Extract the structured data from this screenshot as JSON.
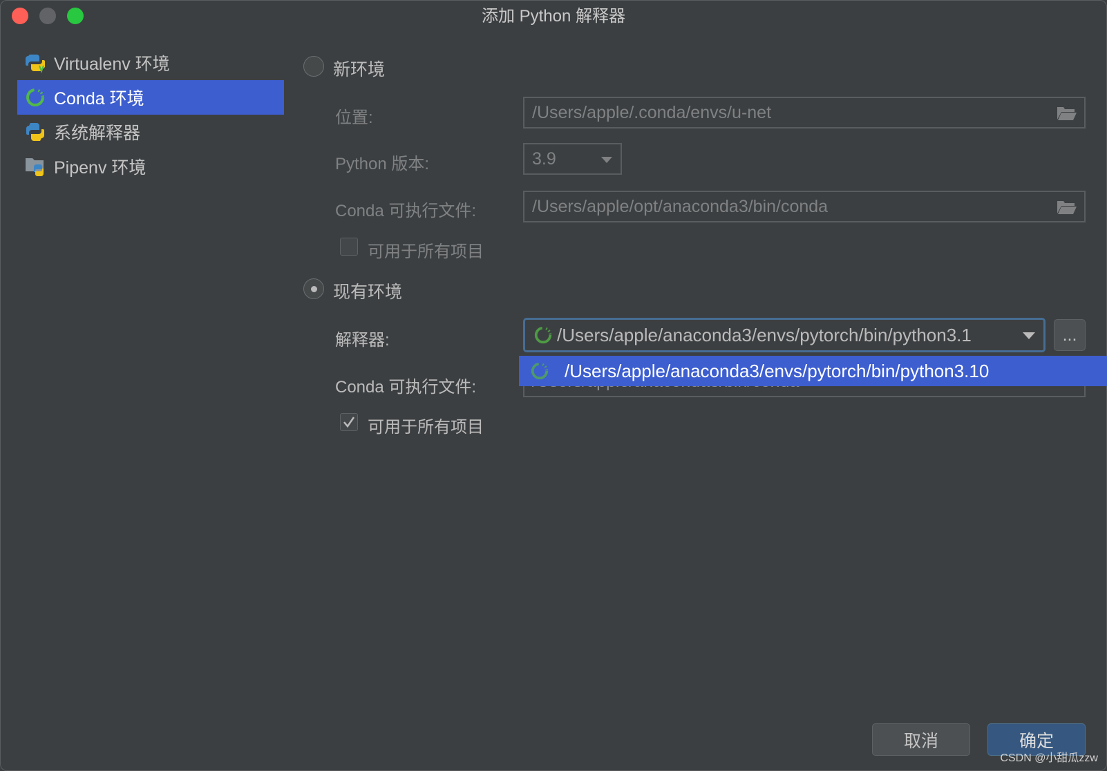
{
  "window": {
    "title": "添加 Python 解释器"
  },
  "sidebar": {
    "items": [
      {
        "label": "Virtualenv 环境",
        "icon": "python-virtualenv-icon"
      },
      {
        "label": "Conda 环境",
        "icon": "conda-icon",
        "selected": true
      },
      {
        "label": "系统解释器",
        "icon": "python-icon"
      },
      {
        "label": "Pipenv 环境",
        "icon": "pipenv-folder-icon"
      }
    ]
  },
  "new_env": {
    "radio_label": "新环境",
    "selected": false,
    "location_label": "位置:",
    "location_value": "/Users/apple/.conda/envs/u-net",
    "python_version_label": "Python 版本:",
    "python_version_value": "3.9",
    "conda_exe_label": "Conda 可执行文件:",
    "conda_exe_value": "/Users/apple/opt/anaconda3/bin/conda",
    "all_projects_label": "可用于所有项目",
    "all_projects_checked": false
  },
  "existing_env": {
    "radio_label": "现有环境",
    "selected": true,
    "interpreter_label": "解释器:",
    "interpreter_value": "/Users/apple/anaconda3/envs/pytorch/bin/python3.1",
    "browse_label": "...",
    "dropdown_option": "/Users/apple/anaconda3/envs/pytorch/bin/python3.10",
    "conda_exe_label": "Conda 可执行文件:",
    "conda_exe_value": "/Users/apple/anaconda3/bin/conda",
    "all_projects_label": "可用于所有项目",
    "all_projects_checked": true
  },
  "buttons": {
    "cancel": "取消",
    "ok": "确定"
  },
  "watermark": "CSDN @小甜瓜zzw",
  "colors": {
    "accent": "#3d5ecf",
    "background": "#3c3f41",
    "focus": "#466d94"
  }
}
